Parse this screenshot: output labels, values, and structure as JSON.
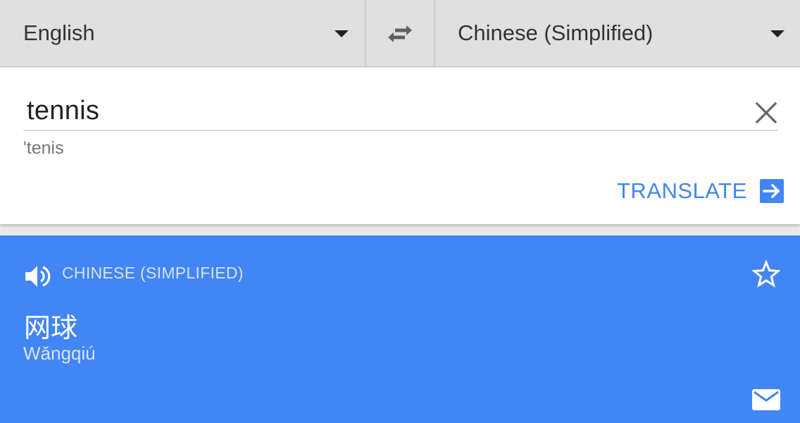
{
  "language_bar": {
    "source_language": "English",
    "target_language": "Chinese (Simplified)",
    "swap_icon": "swap-horizontal-icon",
    "dropdown_icon": "caret-down-icon"
  },
  "input": {
    "text": "tennis",
    "phonetic": "'tenis",
    "clear_icon": "close-icon",
    "translate_label": "TRANSLATE",
    "translate_icon": "arrow-right-box-icon"
  },
  "result": {
    "language_label": "CHINESE (SIMPLIFIED)",
    "translation": "网球",
    "transliteration": "Wǎngqiú",
    "speaker_icon": "speaker-icon",
    "star_icon": "star-outline-icon",
    "mail_icon": "mail-icon"
  },
  "colors": {
    "accent": "#4285f4",
    "toolbar_bg": "#e0e0e0",
    "card_bg": "#ffffff"
  }
}
